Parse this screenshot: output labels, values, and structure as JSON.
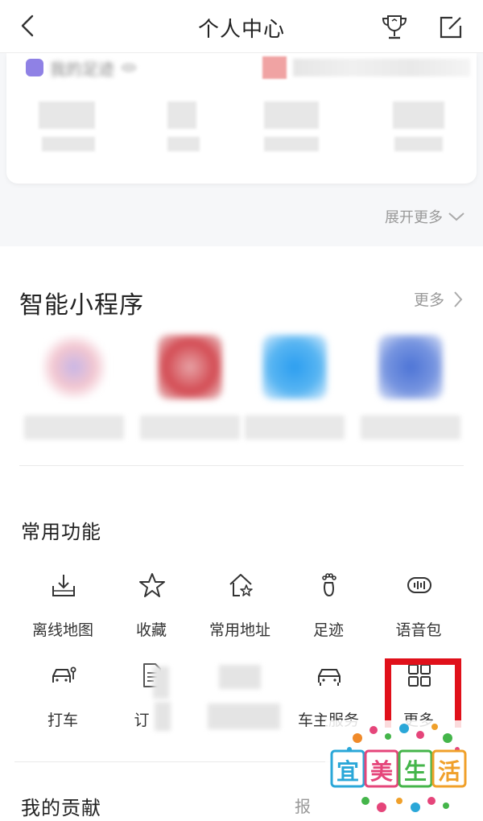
{
  "header": {
    "title": "个人中心",
    "back_icon": "chevron-left-icon",
    "trophy_icon": "trophy-icon",
    "edit_icon": "edit-icon"
  },
  "footprint_card": {
    "label": "我的足迹",
    "expand_label": "展开更多"
  },
  "mini_programs": {
    "title": "智能小程序",
    "more_label": "更多",
    "colors": [
      "#d9c7e8",
      "#d9484f",
      "#2c9ef0",
      "#4d74d6"
    ]
  },
  "common_functions": {
    "title": "常用功能",
    "items": [
      {
        "label": "离线地图",
        "icon": "download-tray-icon"
      },
      {
        "label": "收藏",
        "icon": "star-icon"
      },
      {
        "label": "常用地址",
        "icon": "home-star-icon"
      },
      {
        "label": "足迹",
        "icon": "footprint-icon"
      },
      {
        "label": "语音包",
        "icon": "voice-pack-icon"
      },
      {
        "label": "打车",
        "icon": "taxi-icon"
      },
      {
        "label": "订",
        "icon": "document-icon"
      },
      {
        "label": "",
        "icon": "blurred-icon"
      },
      {
        "label": "车主服务",
        "icon": "car-icon"
      },
      {
        "label": "更多",
        "icon": "grid-icon"
      }
    ]
  },
  "contribution": {
    "title": "我的贡献",
    "right_text": "报"
  },
  "watermark": {
    "text": "宜美生活",
    "chars": [
      "宜",
      "美",
      "生",
      "活"
    ],
    "colors": [
      "#2aa7d8",
      "#e5457a",
      "#44b54a",
      "#f0a02a"
    ]
  },
  "highlight_color": "#e0101a"
}
